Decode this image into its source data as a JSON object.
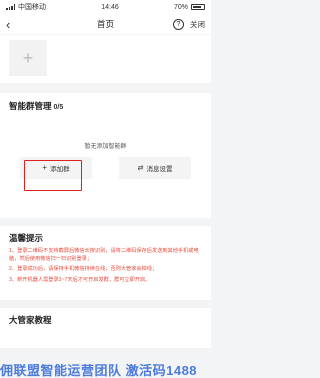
{
  "status_bar": {
    "carrier": "中国移动",
    "time": "14:46",
    "battery": "70%"
  },
  "nav": {
    "title": "首页",
    "help": "?",
    "close": "关闭"
  },
  "add_tile": {
    "icon": "plus-icon"
  },
  "group": {
    "title": "智能群管理",
    "count": "0/5",
    "empty_text": "暂无添加智能群",
    "add_button": "添加群",
    "settings_button": "消息设置"
  },
  "tips": {
    "title": "温馨提示",
    "items": [
      "1、登录二维码不支持截屏后微信长按识别，请将二维码保存后发送到其他手机或电脑，然后使用微信扫一扫识别登录；",
      "2、登录成功后，请保持手机微信持续在线，否则大管家会掉线；",
      "3、新开机器人需登录3~7天后才可开启发群，群可立即开启。"
    ]
  },
  "tutorial": {
    "title": "大管家教程"
  },
  "watermark": "佣联盟智能运营团队 激活码1488",
  "colors": {
    "highlight": "#e02020",
    "tip_text": "#e74c3c",
    "watermark": "#3a6fd8"
  }
}
